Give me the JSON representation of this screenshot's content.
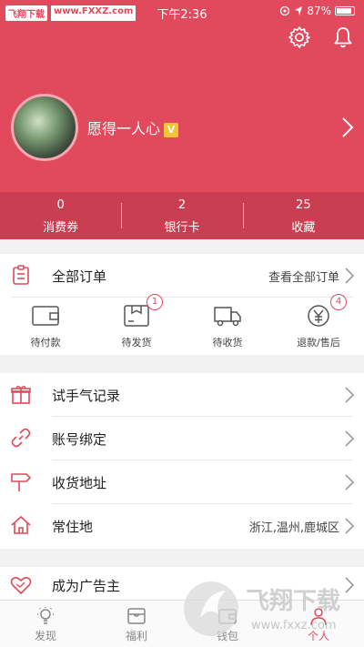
{
  "status": {
    "watermark_badge": "飞翔下载",
    "watermark_url": "www.FXXZ.com",
    "time": "下午2:36",
    "battery": "87%"
  },
  "profile": {
    "username": "愿得一人心",
    "badge": "V"
  },
  "stats": [
    {
      "value": "0",
      "label": "消费券"
    },
    {
      "value": "2",
      "label": "银行卡"
    },
    {
      "value": "25",
      "label": "收藏"
    }
  ],
  "orders": {
    "title": "全部订单",
    "view_all": "查看全部订单",
    "items": [
      {
        "label": "待付款",
        "count": ""
      },
      {
        "label": "待发货",
        "count": "1"
      },
      {
        "label": "待收货",
        "count": ""
      },
      {
        "label": "退款/售后",
        "count": "4"
      }
    ]
  },
  "menu": [
    {
      "label": "试手气记录",
      "value": ""
    },
    {
      "label": "账号绑定",
      "value": ""
    },
    {
      "label": "收货地址",
      "value": ""
    },
    {
      "label": "常住地",
      "value": "浙江,温州,鹿城区"
    }
  ],
  "advertiser": {
    "label": "成为广告主"
  },
  "tabs": [
    {
      "label": "发现"
    },
    {
      "label": "福利"
    },
    {
      "label": "钱包"
    },
    {
      "label": "个人"
    }
  ],
  "watermark_overlay": {
    "text": "飞翔下载",
    "url": "www.fxxz.com"
  },
  "colors": {
    "accent": "#e04a5c",
    "stats_bg": "#c93f51"
  }
}
